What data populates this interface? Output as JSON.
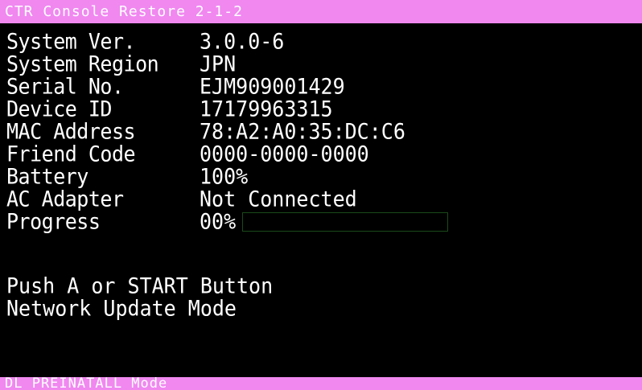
{
  "header": {
    "title": "CTR Console Restore 2-1-2"
  },
  "info_rows": [
    {
      "label": "System Ver.",
      "value": "3.0.0-6"
    },
    {
      "label": "System Region",
      "value": "JPN"
    },
    {
      "label": "Serial No.",
      "value": "EJM909001429"
    },
    {
      "label": "Device ID",
      "value": "17179963315"
    },
    {
      "label": "MAC Address",
      "value": "78:A2:A0:35:DC:C6"
    },
    {
      "label": "Friend Code",
      "value": "0000-0000-0000"
    },
    {
      "label": "Battery",
      "value": "100%"
    },
    {
      "label": "AC Adapter",
      "value": "Not Connected"
    }
  ],
  "progress": {
    "label": "Progress",
    "value_text": "00%",
    "fraction": 0.0
  },
  "messages": [
    "Push A or START Button",
    "Network Update Mode"
  ],
  "footer": {
    "mode_text": "DL_PREINATALL Mode"
  },
  "colors": {
    "bar_background": "#f088f0",
    "screen_background": "#000000",
    "text": "#ffffff",
    "progress_border": "#1a4a1a"
  }
}
